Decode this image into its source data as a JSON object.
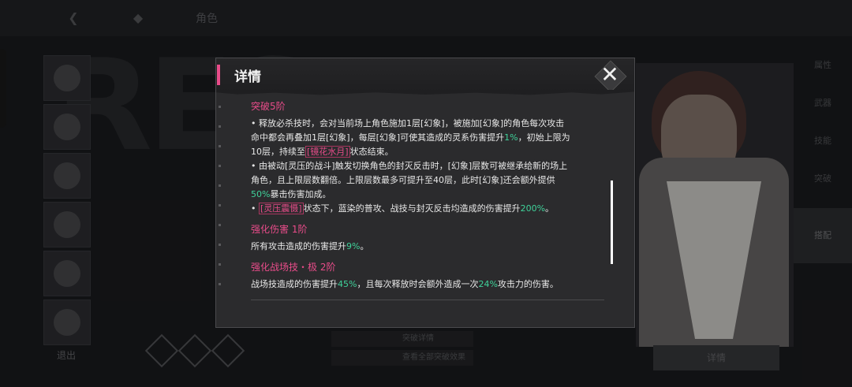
{
  "background": {
    "top_title": "角色",
    "big_word": "RES",
    "back_label": "退出",
    "right_menu": [
      "属性",
      "武器",
      "技能",
      "突破",
      "搭配"
    ],
    "bottom_button": "详情",
    "center_rows": [
      "突破详情",
      "查看全部突破效果"
    ]
  },
  "dialog": {
    "title": "详情",
    "close_icon": "close-icon",
    "sections": [
      {
        "title": "突破5阶",
        "lines": [
          "• 释放必杀技时，会对当前场上角色施加1层[幻象]，被施加[幻象]的角色每次攻击",
          "命中都会再叠加1层[幻象]，每层[幻象]可使其造成的灵系伤害提升",
          "1%",
          "，初始上限为",
          "10层，持续至",
          "[镜花水月]",
          "状态结束。",
          "• 由被动[灵压的战斗]触发切换角色的封灭反击时，[幻象]层数可被继承给新的场上",
          "角色，且上限层数翻倍。上限层数最多可提升至40层，此时[幻象]还会额外提供",
          "50%",
          "暴击伤害加成。",
          "• ",
          "[灵压震慑]",
          "状态下，蓝染的普攻、战技与封灭反击均造成的伤害提升",
          "200%",
          "。"
        ]
      },
      {
        "title": "强化伤害 1阶",
        "lines": [
          "所有攻击造成的伤害提升",
          "9%",
          "。"
        ]
      },
      {
        "title": "强化战场技・极 2阶",
        "lines": [
          "战场技造成的伤害提升",
          "45%",
          "，且每次释放时会额外造成一次",
          "24%",
          "攻击力的伤害。"
        ]
      }
    ]
  },
  "colors": {
    "accent_pink": "#e94c8a",
    "value_green": "#3fd29a",
    "panel": "#2b2b2d"
  }
}
